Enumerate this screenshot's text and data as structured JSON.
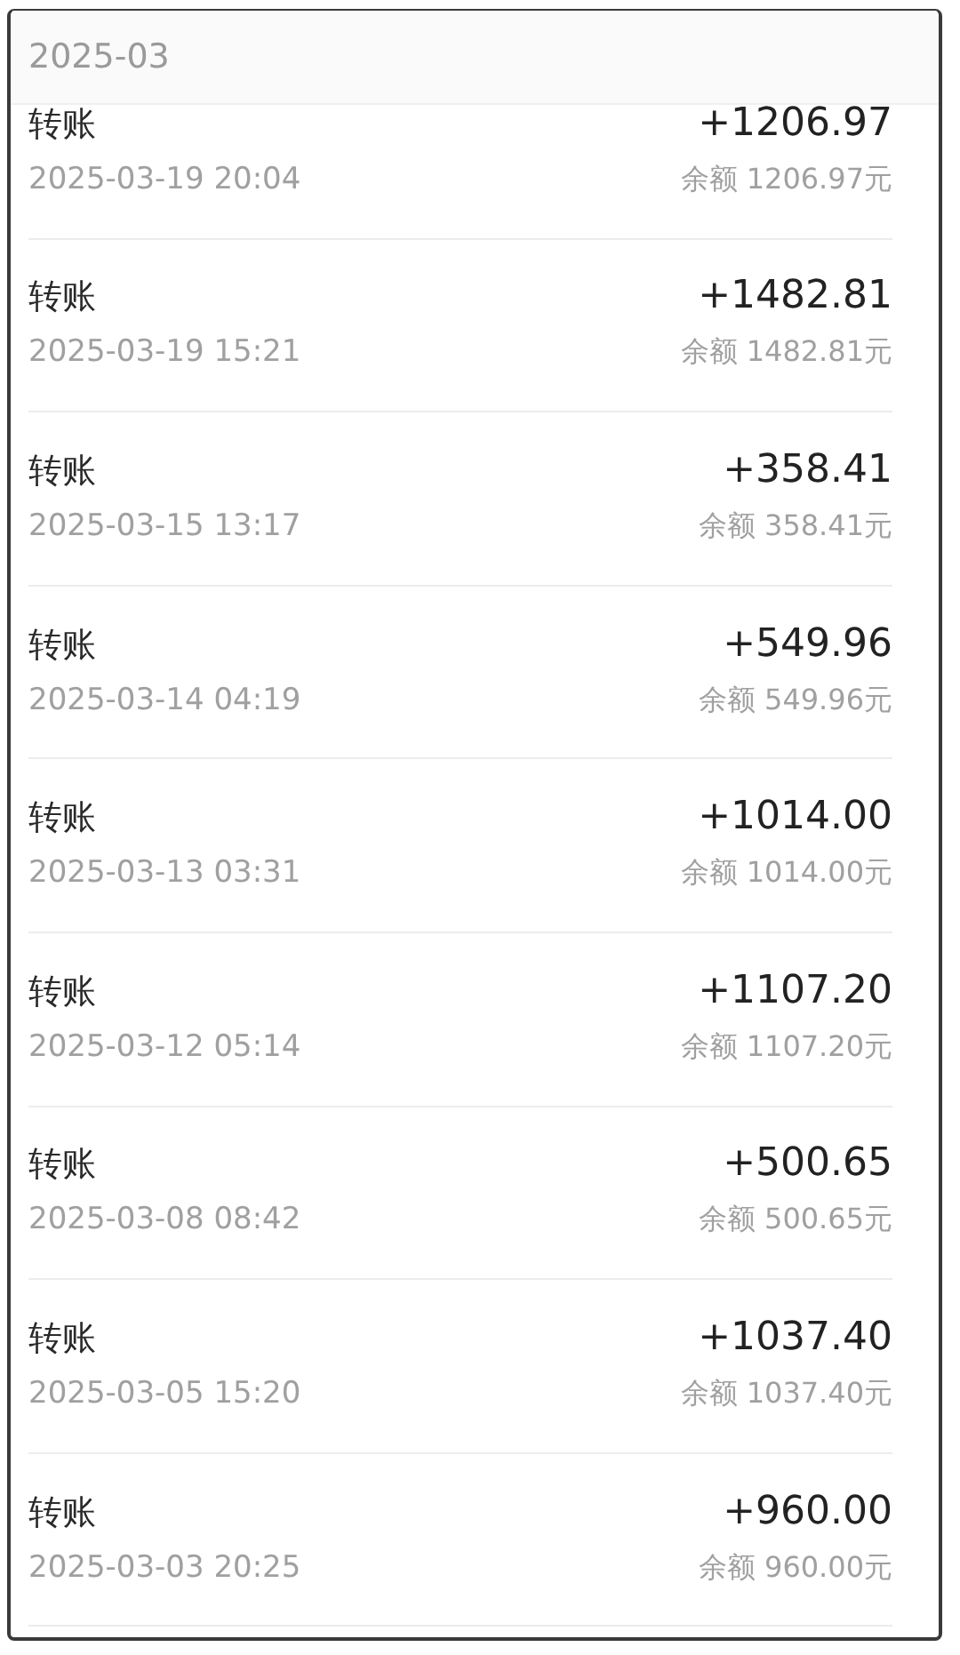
{
  "header": {
    "month": "2025-03"
  },
  "transactions": [
    {
      "title": "转账",
      "amount": "+1206.97",
      "time": "2025-03-19 20:04",
      "balance": "余额 1206.97元"
    },
    {
      "title": "转账",
      "amount": "+1482.81",
      "time": "2025-03-19 15:21",
      "balance": "余额 1482.81元"
    },
    {
      "title": "转账",
      "amount": "+358.41",
      "time": "2025-03-15 13:17",
      "balance": "余额 358.41元"
    },
    {
      "title": "转账",
      "amount": "+549.96",
      "time": "2025-03-14 04:19",
      "balance": "余额 549.96元"
    },
    {
      "title": "转账",
      "amount": "+1014.00",
      "time": "2025-03-13 03:31",
      "balance": "余额 1014.00元"
    },
    {
      "title": "转账",
      "amount": "+1107.20",
      "time": "2025-03-12 05:14",
      "balance": "余额 1107.20元"
    },
    {
      "title": "转账",
      "amount": "+500.65",
      "time": "2025-03-08 08:42",
      "balance": "余额 500.65元"
    },
    {
      "title": "转账",
      "amount": "+1037.40",
      "time": "2025-03-05 15:20",
      "balance": "余额 1037.40元"
    },
    {
      "title": "转账",
      "amount": "+960.00",
      "time": "2025-03-03 20:25",
      "balance": "余额 960.00元"
    }
  ]
}
